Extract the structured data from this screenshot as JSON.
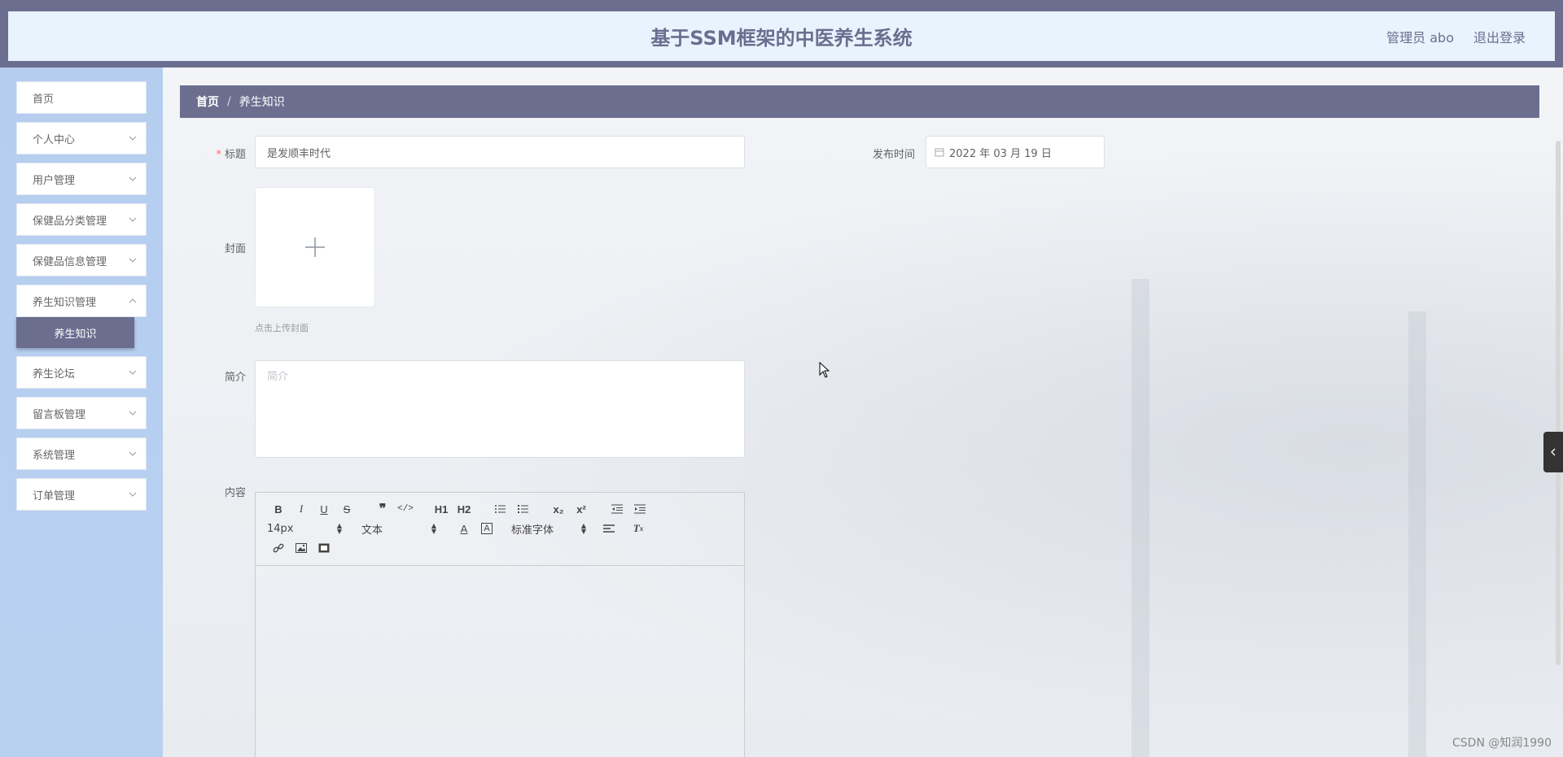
{
  "header": {
    "title": "基于SSM框架的中医养生系统",
    "user_label": "管理员 abo",
    "logout_label": "退出登录"
  },
  "sidebar": {
    "items": [
      {
        "label": "首页"
      },
      {
        "label": "个人中心"
      },
      {
        "label": "用户管理"
      },
      {
        "label": "保健品分类管理"
      },
      {
        "label": "保健品信息管理"
      },
      {
        "label": "养生知识管理"
      },
      {
        "label": "养生论坛"
      },
      {
        "label": "留言板管理"
      },
      {
        "label": "系统管理"
      },
      {
        "label": "订单管理"
      }
    ],
    "active_sub_label": "养生知识"
  },
  "breadcrumb": {
    "home": "首页",
    "separator": "/",
    "current": "养生知识"
  },
  "form": {
    "title_label": "标题",
    "title_value": "是发顺丰时代",
    "publish_time_label": "发布时间",
    "publish_time_value": "2022 年 03 月 19 日",
    "cover_label": "封面",
    "cover_hint": "点击上传封面",
    "intro_label": "简介",
    "intro_placeholder": "简介",
    "content_label": "内容"
  },
  "editor": {
    "font_size": "14px",
    "header_select": "文本",
    "font_family": "标准字体",
    "h1": "H1",
    "h2": "H2"
  },
  "watermark": "CSDN @知润1990",
  "colors": {
    "primary": "#6b6e8f",
    "header_bg": "#e8f3fd",
    "sidebar_bg": "#b5cdef",
    "required": "#f56c6c"
  }
}
